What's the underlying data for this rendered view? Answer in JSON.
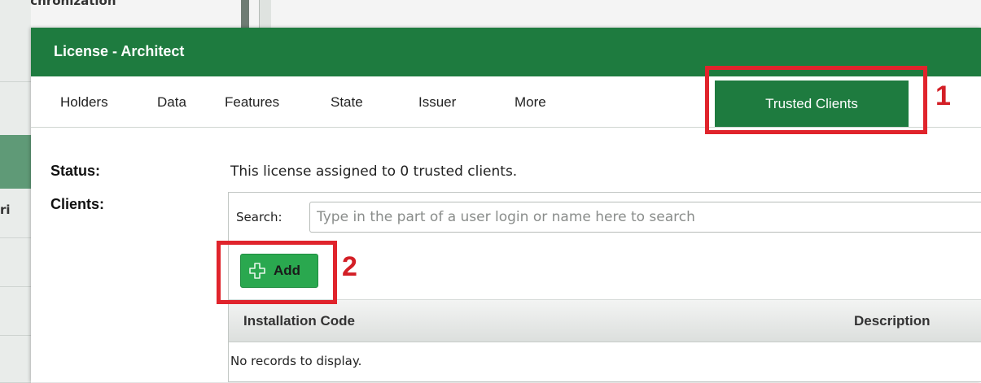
{
  "background": {
    "top_strip_text": "Synchronization",
    "side_text": "ri"
  },
  "dialog": {
    "title": "License - Architect",
    "tabs": [
      {
        "label": "Holders"
      },
      {
        "label": "Data"
      },
      {
        "label": "Features"
      },
      {
        "label": "State"
      },
      {
        "label": "Issuer"
      },
      {
        "label": "More"
      },
      {
        "label": "Trusted Clients",
        "active": true
      }
    ],
    "status_label": "Status:",
    "status_value": "This license assigned to 0 trusted clients.",
    "clients_label": "Clients:",
    "search": {
      "label": "Search:",
      "placeholder": "Type in the part of a user login or name here to search",
      "value": ""
    },
    "add_button_label": "Add",
    "grid": {
      "columns": [
        "Installation Code",
        "Description"
      ],
      "rows": [],
      "empty_message": "No records to display."
    }
  },
  "annotations": [
    {
      "number": "1",
      "target": "Trusted Clients tab"
    },
    {
      "number": "2",
      "target": "Add button"
    }
  ],
  "colors": {
    "brand_green": "#1e7b3f",
    "add_button_green": "#2aa84f",
    "highlight_red": "#e0242c"
  }
}
